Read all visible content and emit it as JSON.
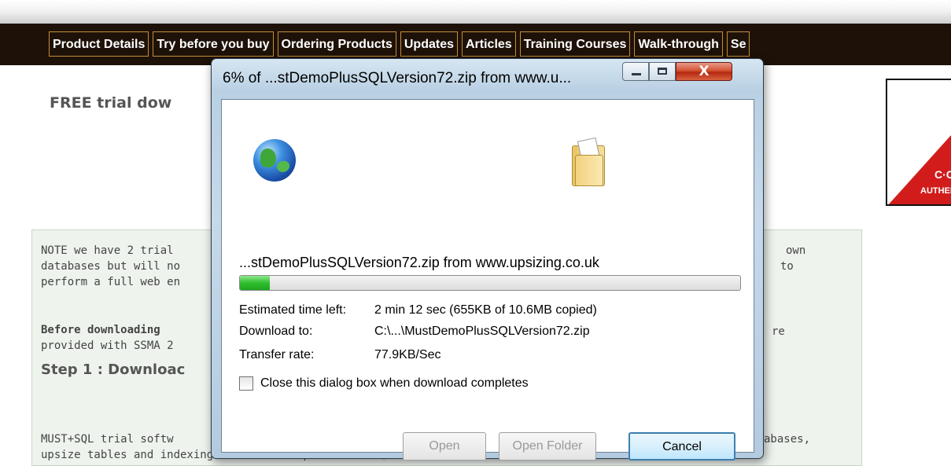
{
  "nav": {
    "items": [
      "Product Details",
      "Try before you buy",
      "Ordering Products",
      "Updates",
      "Articles",
      "Training Courses",
      "Walk-through",
      "Se"
    ]
  },
  "page": {
    "heading": "FREE trial dow",
    "ad_text1": "C·C",
    "ad_text2": "AUTHEN",
    "note_lines": [
      "NOTE we have 2 trial",
      "databases but will no",
      "perform a full web en"
    ],
    "note_right": [
      "own",
      "to",
      "re"
    ],
    "before_bold": "Before downloading",
    "before_rest": "provided with SSMA 2",
    "step1": "Step 1 : Downloac",
    "bottom_line1_left": "MUST+SQL trial softw",
    "bottom_line1_right": "abases,",
    "bottom_line2": "upsize tables and indexing and convert queries to SQL Server views and stored procedures."
  },
  "dialog": {
    "title": "6% of ...stDemoPlusSQLVersion72.zip from www.u...",
    "close_glyph": "X",
    "file_line": "...stDemoPlusSQLVersion72.zip from www.upsizing.co.uk",
    "progress_fraction": 0.06,
    "labels": {
      "time_left": "Estimated time left:",
      "download_to": "Download to:",
      "transfer_rate": "Transfer rate:"
    },
    "values": {
      "time_left": "2 min 12 sec (655KB of 10.6MB copied)",
      "download_to": "C:\\...\\MustDemoPlusSQLVersion72.zip",
      "transfer_rate": "77.9KB/Sec"
    },
    "checkbox_label": "Close this dialog box when download completes",
    "checkbox_checked": false,
    "buttons": {
      "open": "Open",
      "open_folder": "Open Folder",
      "cancel": "Cancel"
    }
  }
}
